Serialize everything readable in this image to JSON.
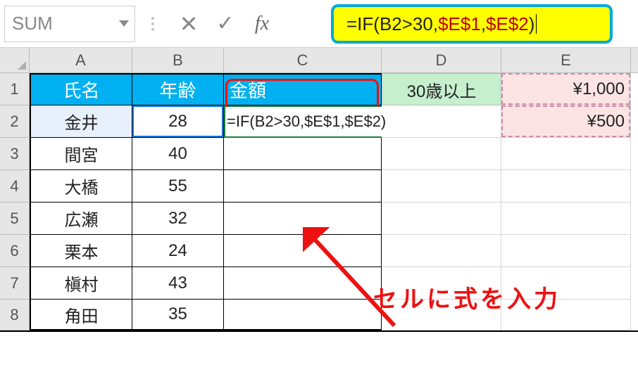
{
  "name_box": "SUM",
  "fx_label": "fx",
  "formula_bar": {
    "prefix": "=IF(B2>30,",
    "arg1": "$E$1",
    "comma": ",",
    "arg2": "$E$2",
    "suffix": ")"
  },
  "columns": [
    "A",
    "B",
    "C",
    "D",
    "E"
  ],
  "row_numbers": [
    "1",
    "2",
    "3",
    "4",
    "5",
    "6",
    "7",
    "8"
  ],
  "headers": {
    "A": "氏名",
    "B": "年齢",
    "C": "金額",
    "D": "30歳以上",
    "E": "¥1,000"
  },
  "row2_E": "¥500",
  "cell_formula": "=IF(B2>30,$E$1,$E$2)",
  "table": [
    {
      "name": "金井",
      "age": "28"
    },
    {
      "name": "間宮",
      "age": "40"
    },
    {
      "name": "大橋",
      "age": "55"
    },
    {
      "name": "広瀬",
      "age": "32"
    },
    {
      "name": "栗本",
      "age": "24"
    },
    {
      "name": "槇村",
      "age": "43"
    },
    {
      "name": "角田",
      "age": "35"
    }
  ],
  "annotation": "セルに式を入力"
}
